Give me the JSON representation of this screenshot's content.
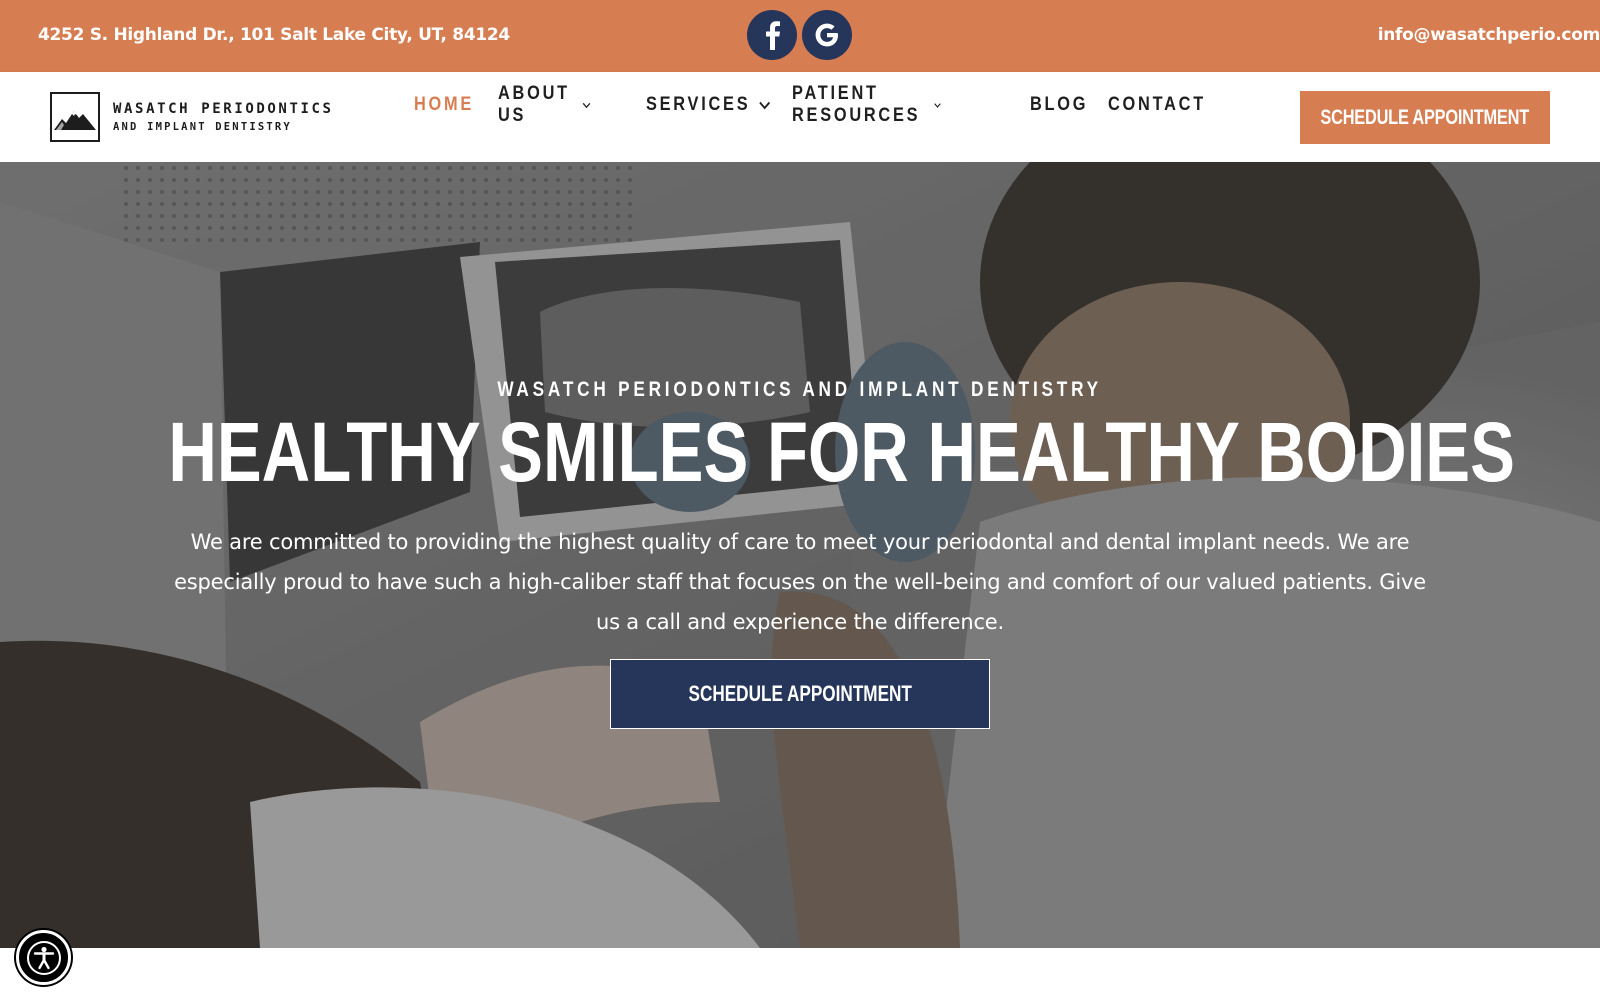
{
  "topbar": {
    "address": "4252 S. Highland Dr., 101 Salt Lake City, UT, 84124",
    "email": "info@wasatchperio.com",
    "social": [
      {
        "icon": "facebook-icon"
      },
      {
        "icon": "google-icon"
      }
    ],
    "background": "#d77d52"
  },
  "logo": {
    "line1": "WASATCH PERIODONTICS",
    "line2": "AND IMPLANT DENTISTRY"
  },
  "nav": {
    "home": "HOME",
    "about": "ABOUT US",
    "services": "SERVICES",
    "patient_resources": "PATIENT RESOURCES",
    "blog": "BLOG",
    "contact": "CONTACT",
    "active": "HOME"
  },
  "header": {
    "cta": "SCHEDULE APPOINTMENT"
  },
  "hero": {
    "eyebrow": "WASATCH PERIODONTICS AND IMPLANT DENTISTRY",
    "title": "HEALTHY SMILES FOR HEALTHY BODIES",
    "text": "We are committed to providing the highest quality of care to meet your periodontal and dental implant needs. We are especially proud to have such a high-caliber staff that focuses on the well-being and comfort of our valued patients. Give us a call and experience the difference.",
    "cta": "SCHEDULE APPOINTMENT"
  },
  "colors": {
    "accent": "#d77d52",
    "navy": "#26355a"
  },
  "accessibility": {
    "icon": "accessibility-icon"
  }
}
